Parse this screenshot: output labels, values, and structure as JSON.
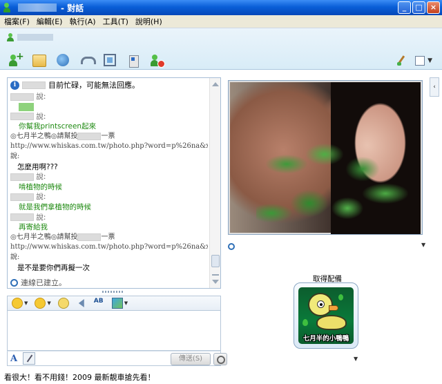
{
  "window": {
    "title": "- 對話",
    "buttons": {
      "minimize": "_",
      "maximize": "□",
      "close": "×"
    }
  },
  "menu": {
    "items": [
      "檔案(F)",
      "編輯(E)",
      "執行(A)",
      "工具(T)",
      "說明(H)"
    ]
  },
  "toolbar": {
    "icons": [
      "invite-contact-icon",
      "share-files-icon",
      "video-call-icon",
      "voice-call-icon",
      "activities-icon",
      "games-icon",
      "block-contact-icon"
    ],
    "right_icons": [
      "theme-brush-icon",
      "layout-icon"
    ]
  },
  "status": {
    "message": "目前忙碌，可能無法回應。"
  },
  "conversation": {
    "said_suffix": "說:",
    "lines": [
      {
        "kind": "said"
      },
      {
        "kind": "green_box"
      },
      {
        "kind": "said"
      },
      {
        "kind": "green",
        "text": "你幫我printscreen起來"
      },
      {
        "kind": "sys",
        "text": "◎七月半之鴨◎請幫投",
        "suffix": "一票"
      },
      {
        "kind": "sys",
        "text": "http://www.whiskas.com.tw/photo.php?word=p%26na&x=10&y=6"
      },
      {
        "kind": "sys",
        "text": "說:"
      },
      {
        "kind": "black",
        "text": "怎麼用啊???"
      },
      {
        "kind": "said"
      },
      {
        "kind": "green",
        "text": "啃植物的時候"
      },
      {
        "kind": "said"
      },
      {
        "kind": "green",
        "text": "就是我們拿植物的時候"
      },
      {
        "kind": "said"
      },
      {
        "kind": "green",
        "text": "再寄給我"
      },
      {
        "kind": "sys",
        "text": "◎七月半之鴨◎請幫投",
        "suffix": "一票"
      },
      {
        "kind": "sys",
        "text": "http://www.whiskas.com.tw/photo.php?word=p%26na&x=10&y=6"
      },
      {
        "kind": "sys",
        "text": "說:"
      },
      {
        "kind": "black",
        "text": "是不是要你們再擬一次"
      }
    ],
    "connection": "連線已建立。"
  },
  "compose": {
    "send_label": "傳送(S)",
    "icons": [
      "emoticon-icon",
      "wink-icon",
      "voice-clip-icon",
      "nudge-icon",
      "font-icon",
      "background-icon"
    ]
  },
  "ad": {
    "text": "看很大！看不用錢！2009 最新靚車搶先看！"
  },
  "display_picture": {
    "label": "取得配備",
    "caption": "七月半的小鴨鴨"
  },
  "colors": {
    "titlebar": "#0a5fd8",
    "green_text": "#1f8a12",
    "header_band": "#d8ecf7"
  }
}
